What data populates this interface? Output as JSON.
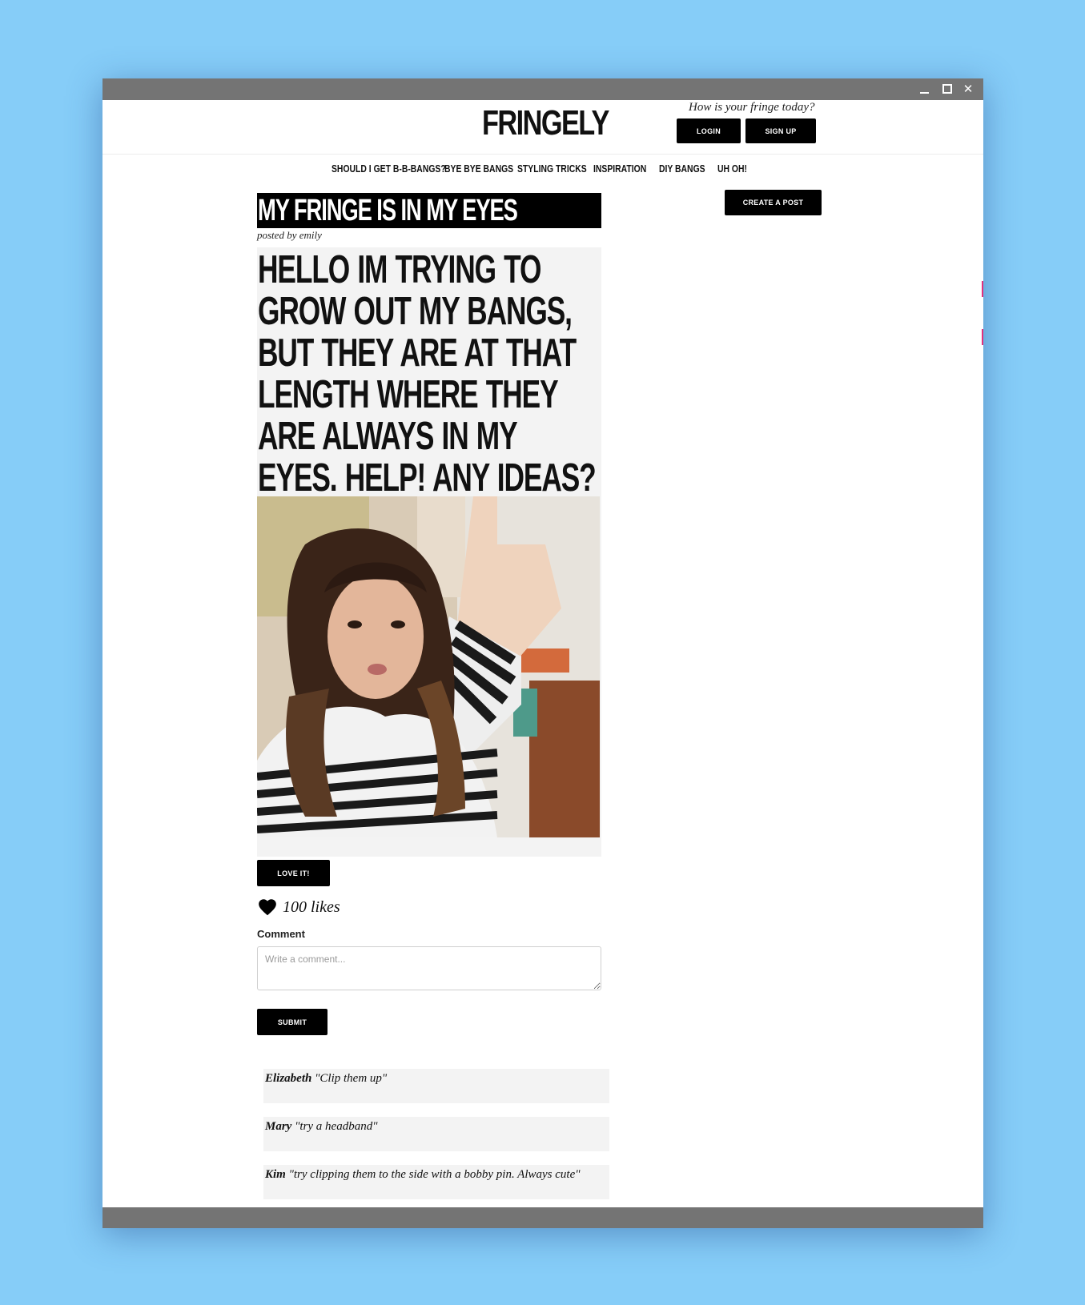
{
  "window": {
    "controls": [
      "minimize-icon",
      "maximize-icon",
      "close-icon"
    ]
  },
  "header": {
    "logo": "FRINGELY",
    "tagline": "How is your fringe today?",
    "login_label": "LOGIN",
    "signup_label": "SIGN UP"
  },
  "nav": {
    "items": [
      {
        "label": "SHOULD I GET B-B-BANGS?"
      },
      {
        "label": "BYE BYE BANGS"
      },
      {
        "label": "STYLING TRICKS"
      },
      {
        "label": "INSPIRATION"
      },
      {
        "label": "DIY BANGS"
      },
      {
        "label": "UH OH!"
      }
    ]
  },
  "sidebar": {
    "create_post_label": "CREATE A POST"
  },
  "post": {
    "title": "MY FRINGE IS IN MY EYES",
    "posted_by": "posted by emily",
    "body": "HELLO IM TRYING TO GROW OUT MY BANGS, BUT THEY ARE AT THAT LENGTH WHERE THEY ARE ALWAYS IN MY EYES. HELP! ANY IDEAS?",
    "love_label": "LOVE IT!",
    "likes": "100 likes"
  },
  "comment_form": {
    "label": "Comment",
    "placeholder": "Write a comment...",
    "submit_label": "SUBMIT"
  },
  "comments": [
    {
      "author": "Elizabeth",
      "text": "\"Clip them up\""
    },
    {
      "author": "Mary",
      "text": "\"try a headband\""
    },
    {
      "author": "Kim",
      "text": "\"try clipping them to the side with a bobby pin. Always cute\""
    }
  ],
  "colors": {
    "page_background": "#86cdf8",
    "window_chrome": "#747474",
    "button": "#000000",
    "card_background": "#f3f3f3"
  }
}
